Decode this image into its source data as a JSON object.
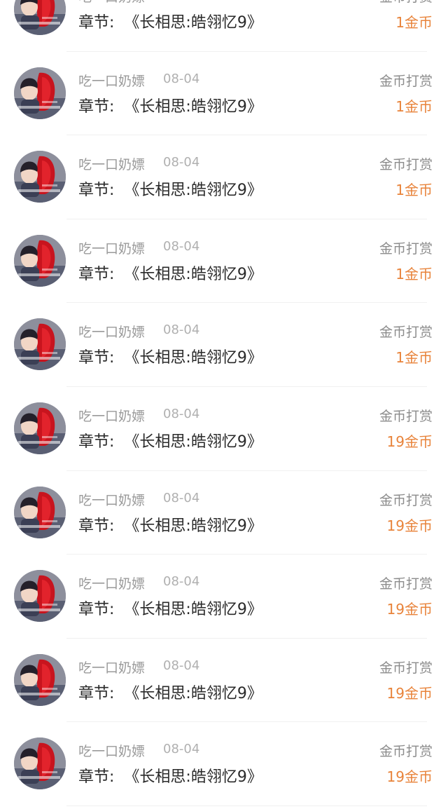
{
  "reward_list": {
    "items": [
      {
        "username": "吃一口奶嫖",
        "date": "08-04",
        "chapter_label": "章节:",
        "chapter_title": "《长相思:皓翎忆9》",
        "reward_type": "金币打赏",
        "amount": "1金币",
        "avatar_icon": "user-avatar"
      },
      {
        "username": "吃一口奶嫖",
        "date": "08-04",
        "chapter_label": "章节:",
        "chapter_title": "《长相思:皓翎忆9》",
        "reward_type": "金币打赏",
        "amount": "1金币",
        "avatar_icon": "user-avatar"
      },
      {
        "username": "吃一口奶嫖",
        "date": "08-04",
        "chapter_label": "章节:",
        "chapter_title": "《长相思:皓翎忆9》",
        "reward_type": "金币打赏",
        "amount": "1金币",
        "avatar_icon": "user-avatar"
      },
      {
        "username": "吃一口奶嫖",
        "date": "08-04",
        "chapter_label": "章节:",
        "chapter_title": "《长相思:皓翎忆9》",
        "reward_type": "金币打赏",
        "amount": "1金币",
        "avatar_icon": "user-avatar"
      },
      {
        "username": "吃一口奶嫖",
        "date": "08-04",
        "chapter_label": "章节:",
        "chapter_title": "《长相思:皓翎忆9》",
        "reward_type": "金币打赏",
        "amount": "1金币",
        "avatar_icon": "user-avatar"
      },
      {
        "username": "吃一口奶嫖",
        "date": "08-04",
        "chapter_label": "章节:",
        "chapter_title": "《长相思:皓翎忆9》",
        "reward_type": "金币打赏",
        "amount": "19金币",
        "avatar_icon": "user-avatar"
      },
      {
        "username": "吃一口奶嫖",
        "date": "08-04",
        "chapter_label": "章节:",
        "chapter_title": "《长相思:皓翎忆9》",
        "reward_type": "金币打赏",
        "amount": "19金币",
        "avatar_icon": "user-avatar"
      },
      {
        "username": "吃一口奶嫖",
        "date": "08-04",
        "chapter_label": "章节:",
        "chapter_title": "《长相思:皓翎忆9》",
        "reward_type": "金币打赏",
        "amount": "19金币",
        "avatar_icon": "user-avatar"
      },
      {
        "username": "吃一口奶嫖",
        "date": "08-04",
        "chapter_label": "章节:",
        "chapter_title": "《长相思:皓翎忆9》",
        "reward_type": "金币打赏",
        "amount": "19金币",
        "avatar_icon": "user-avatar"
      },
      {
        "username": "吃一口奶嫖",
        "date": "08-04",
        "chapter_label": "章节:",
        "chapter_title": "《长相思:皓翎忆9》",
        "reward_type": "金币打赏",
        "amount": "19金币",
        "avatar_icon": "user-avatar"
      }
    ]
  },
  "colors": {
    "amount": "#e8833a",
    "username": "#9a9a9a",
    "chapter_text": "#2a2a2a",
    "divider": "#f0f0f0"
  }
}
